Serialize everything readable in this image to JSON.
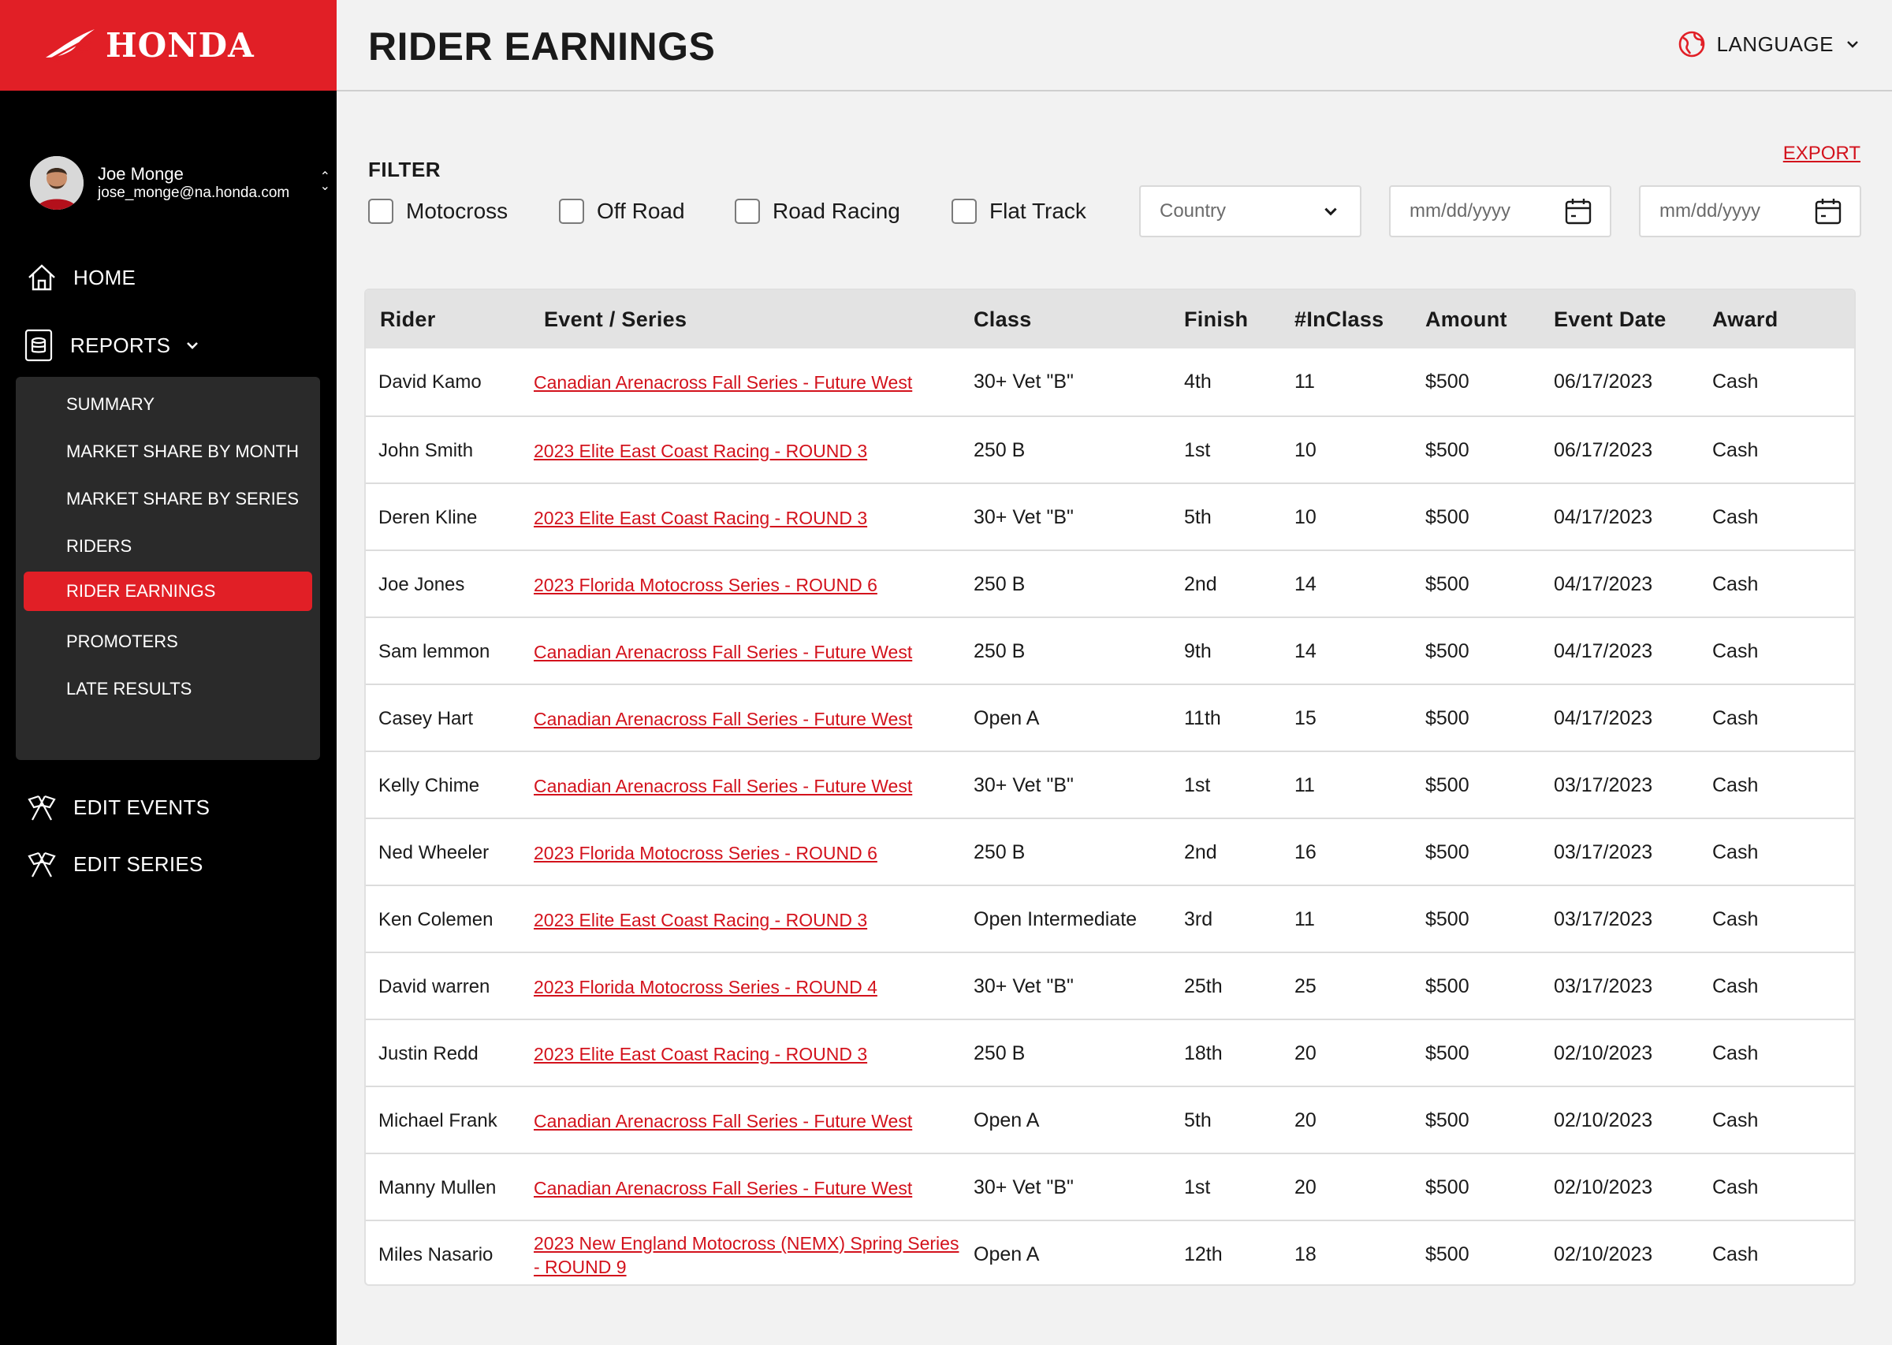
{
  "brand": {
    "name": "HONDA"
  },
  "user": {
    "name": "Joe Monge",
    "email": "jose_monge@na.honda.com"
  },
  "nav": {
    "home": "HOME",
    "reports": "REPORTS",
    "sub": [
      "SUMMARY",
      "MARKET SHARE BY MONTH",
      "MARKET SHARE BY SERIES",
      "RIDERS",
      "RIDER EARNINGS",
      "PROMOTERS",
      "LATE RESULTS"
    ],
    "edit_events": "EDIT EVENTS",
    "edit_series": "EDIT SERIES"
  },
  "header": {
    "title": "RIDER EARNINGS",
    "language": "LANGUAGE"
  },
  "filter": {
    "title": "FILTER",
    "export": "EXPORT",
    "checks": [
      "Motocross",
      "Off Road",
      "Road Racing",
      "Flat Track"
    ],
    "country_placeholder": "Country",
    "date_from_placeholder": "mm/dd/yyyy",
    "date_to_placeholder": "mm/dd/yyyy"
  },
  "table": {
    "columns": [
      "Rider",
      "Event / Series",
      "Class",
      "Finish",
      "#InClass",
      "Amount",
      "Event Date",
      "Award"
    ],
    "rows": [
      [
        "David Kamo",
        "Canadian Arenacross Fall Series - Future West",
        "30+ Vet \"B\"",
        "4th",
        "11",
        "$500",
        "06/17/2023",
        "Cash"
      ],
      [
        "John Smith",
        "2023 Elite East Coast Racing - ROUND 3",
        "250 B",
        "1st",
        "10",
        "$500",
        "06/17/2023",
        "Cash"
      ],
      [
        "Deren Kline",
        "2023 Elite East Coast Racing - ROUND 3",
        "30+ Vet \"B\"",
        "5th",
        "10",
        "$500",
        "04/17/2023",
        "Cash"
      ],
      [
        "Joe Jones",
        "2023 Florida Motocross Series - ROUND 6",
        "250 B",
        "2nd",
        "14",
        "$500",
        "04/17/2023",
        "Cash"
      ],
      [
        "Sam lemmon",
        "Canadian Arenacross Fall Series - Future West",
        "250 B",
        "9th",
        "14",
        "$500",
        "04/17/2023",
        "Cash"
      ],
      [
        "Casey Hart",
        "Canadian Arenacross Fall Series - Future West",
        "Open A",
        "11th",
        "15",
        "$500",
        "04/17/2023",
        "Cash"
      ],
      [
        "Kelly Chime",
        "Canadian Arenacross Fall Series - Future West",
        "30+ Vet \"B\"",
        "1st",
        "11",
        "$500",
        "03/17/2023",
        "Cash"
      ],
      [
        "Ned Wheeler",
        "2023 Florida Motocross Series - ROUND 6",
        "250 B",
        "2nd",
        "16",
        "$500",
        "03/17/2023",
        "Cash"
      ],
      [
        "Ken Colemen",
        "2023 Elite East Coast Racing - ROUND 3",
        "Open Intermediate",
        "3rd",
        "11",
        "$500",
        "03/17/2023",
        "Cash"
      ],
      [
        "David warren",
        "2023 Florida Motocross Series - ROUND 4",
        "30+ Vet \"B\"",
        "25th",
        "25",
        "$500",
        "03/17/2023",
        "Cash"
      ],
      [
        "Justin Redd",
        "2023 Elite East Coast Racing - ROUND 3",
        "250 B",
        "18th",
        "20",
        "$500",
        "02/10/2023",
        "Cash"
      ],
      [
        "Michael Frank",
        "Canadian Arenacross Fall Series - Future West",
        "Open A",
        "5th",
        "20",
        "$500",
        "02/10/2023",
        "Cash"
      ],
      [
        "Manny Mullen",
        "Canadian Arenacross Fall Series - Future West",
        "30+ Vet \"B\"",
        "1st",
        "20",
        "$500",
        "02/10/2023",
        "Cash"
      ],
      [
        "Miles Nasario",
        "2023 New England Motocross (NEMX) Spring Series - ROUND 9",
        "Open A",
        "12th",
        "18",
        "$500",
        "02/10/2023",
        "Cash"
      ]
    ]
  },
  "colors": {
    "brand_red": "#e11f26",
    "link_red": "#d3121c",
    "sidebar_bg": "#000000",
    "submenu_bg": "#2a2a2a"
  }
}
